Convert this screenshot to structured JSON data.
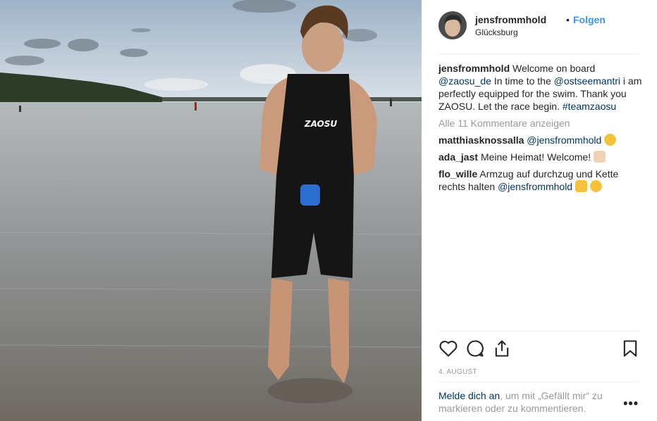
{
  "post": {
    "username": "jensfrommhold",
    "separator": "•",
    "follow_label": "Folgen",
    "location": "Glücksburg",
    "photo_text": "ZAOSU"
  },
  "caption": {
    "username": "jensfrommhold",
    "part1": "Welcome on board",
    "mention1": "@zaosu_de",
    "part2": "In time to the",
    "mention2": "@ostseemantri",
    "part3": "i am perfectly equipped for the swim. Thank you ZAOSU. Let the race begin.",
    "hashtag": "#teamzaosu"
  },
  "comments_link": "Alle 11 Kommentare anzeigen",
  "comments": [
    {
      "user": "matthiasknossalla",
      "text": "",
      "mention": "@jensfrommhold",
      "emoji": "laughing-tears-emoji"
    },
    {
      "user": "ada_jast",
      "text": "Meine Heimat! Welcome!",
      "mention": "",
      "emoji": "clapping-hands-emoji"
    },
    {
      "user": "flo_wille",
      "text": "Armzug auf durchzug und Kette rechts halten",
      "mention": "@jensfrommhold",
      "emoji": "ok-hand-emoji"
    }
  ],
  "actions": {
    "like_icon": "heart-icon",
    "comment_icon": "comment-bubble-icon",
    "share_icon": "share-icon",
    "save_icon": "bookmark-icon"
  },
  "date": "4. AUGUST",
  "login_prompt": {
    "link": "Melde dich an",
    "rest": ", um mit „Gefällt mir“ zu markieren oder zu kommentieren."
  },
  "more_label": "•••",
  "colors": {
    "link_blue": "#3897f0",
    "mention": "#003569",
    "muted": "#999999"
  }
}
